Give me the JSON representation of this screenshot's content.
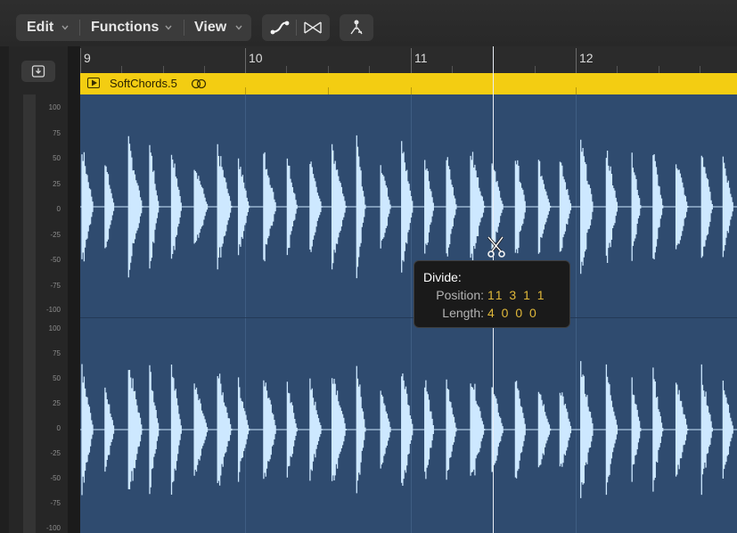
{
  "toolbar": {
    "menus": [
      {
        "label": "Edit"
      },
      {
        "label": "Functions"
      },
      {
        "label": "View"
      }
    ],
    "tools": [
      {
        "icon": "automation-curve-icon"
      },
      {
        "icon": "crossfade-icon"
      },
      {
        "icon": "flex-tool-icon"
      }
    ]
  },
  "inspector_button": {
    "icon": "download-tray-icon"
  },
  "ruler": {
    "bars": [
      "9",
      "10",
      "11",
      "12"
    ]
  },
  "region": {
    "name": "SoftChords.5",
    "color": "#f3cd12",
    "loop_icon": "loop-icon"
  },
  "amplitude_scale": {
    "top_channel": [
      "100",
      "75",
      "50",
      "25",
      "0",
      "-25",
      "-50",
      "-75",
      "-100"
    ],
    "bottom_channel": [
      "100",
      "75",
      "50",
      "25",
      "0",
      "-25",
      "-50",
      "-75",
      "-100"
    ]
  },
  "waveform": {
    "background": "#2f4b6f",
    "color": "#cde8ff"
  },
  "tooltip": {
    "title": "Divide:",
    "position_label": "Position:",
    "position_value": "11 3 1 1",
    "length_label": "Length:",
    "length_value": "4 0 0 0"
  },
  "cursor": {
    "icon": "scissors-icon"
  }
}
